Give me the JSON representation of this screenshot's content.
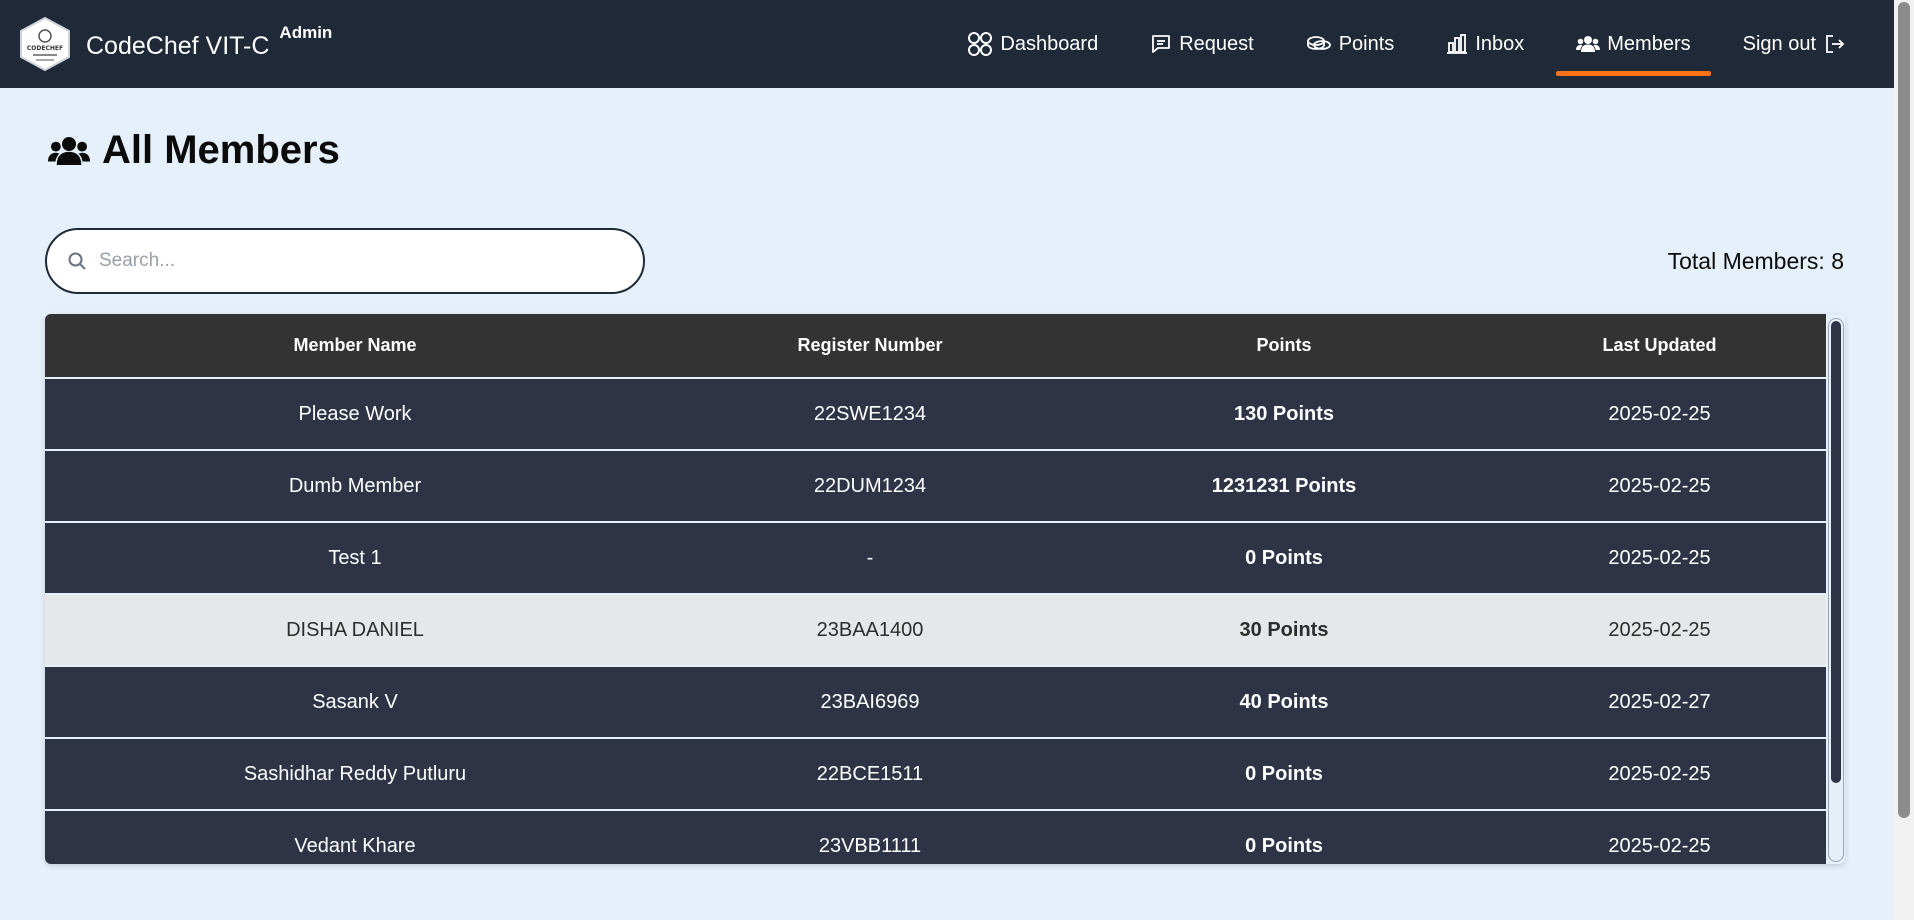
{
  "nav": {
    "brand": "CodeChef VIT-C",
    "badge": "Admin",
    "logo_text": "CODECHEF",
    "items": [
      {
        "label": "Dashboard",
        "icon": "dashboard-icon"
      },
      {
        "label": "Request",
        "icon": "message-icon"
      },
      {
        "label": "Points",
        "icon": "coins-icon"
      },
      {
        "label": "Inbox",
        "icon": "bar-chart-icon"
      },
      {
        "label": "Members",
        "icon": "users-icon"
      }
    ],
    "signout": "Sign out",
    "active": "Members",
    "accent_color": "#f97316"
  },
  "page": {
    "title": "All Members",
    "title_icon": "users-icon"
  },
  "search": {
    "placeholder": "Search..."
  },
  "total": {
    "label": "Total Members: 8"
  },
  "table": {
    "columns": [
      "Member Name",
      "Register Number",
      "Points",
      "Last Updated"
    ],
    "rows": [
      {
        "name": "Please Work",
        "reg": "22SWE1234",
        "points": "130 Points",
        "updated": "2025-02-25"
      },
      {
        "name": "Dumb Member",
        "reg": "22DUM1234",
        "points": "1231231 Points",
        "updated": "2025-02-25"
      },
      {
        "name": "Test 1",
        "reg": "-",
        "points": "0 Points",
        "updated": "2025-02-25"
      },
      {
        "name": "DISHA DANIEL",
        "reg": "23BAA1400",
        "points": "30 Points",
        "updated": "2025-02-25"
      },
      {
        "name": "Sasank V",
        "reg": "23BAI6969",
        "points": "40 Points",
        "updated": "2025-02-27"
      },
      {
        "name": "Sashidhar Reddy Putluru",
        "reg": "22BCE1511",
        "points": "0 Points",
        "updated": "2025-02-25"
      },
      {
        "name": "Vedant Khare",
        "reg": "23VBB1111",
        "points": "0 Points",
        "updated": "2025-02-25"
      }
    ]
  }
}
